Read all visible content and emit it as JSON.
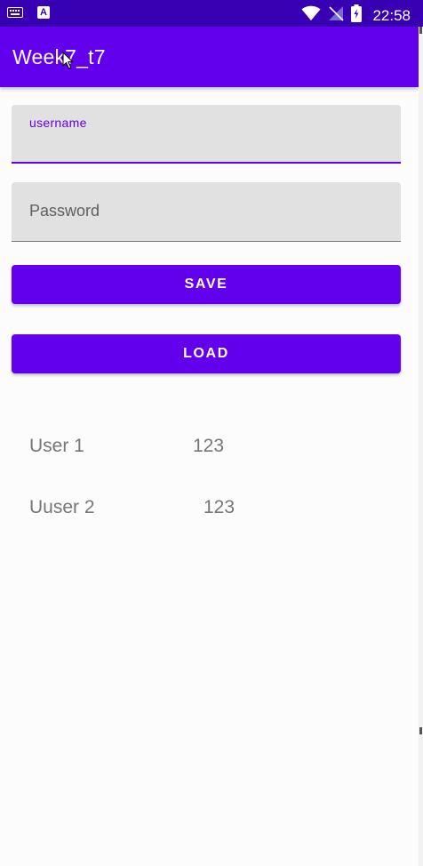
{
  "status_bar": {
    "clock": "22:58",
    "keyboard_icon": "keyboard-icon",
    "app_icon_letter": "A",
    "wifi_icon": "wifi-icon",
    "signal_icon": "signal-off-icon",
    "battery_icon": "battery-charging-icon"
  },
  "app_bar": {
    "title": "Week7_t7"
  },
  "form": {
    "username_label": "username",
    "username_value": "",
    "password_placeholder": "Password"
  },
  "buttons": {
    "save_label": "SAVE",
    "load_label": "LOAD"
  },
  "users": [
    {
      "name": "User 1",
      "value": "123"
    },
    {
      "name": "Uuser 2",
      "value": "123"
    }
  ],
  "colors": {
    "primary": "#6200ee",
    "primary_dark": "#3700b3",
    "field_background": "#e1e1e1",
    "list_text": "#767676"
  }
}
